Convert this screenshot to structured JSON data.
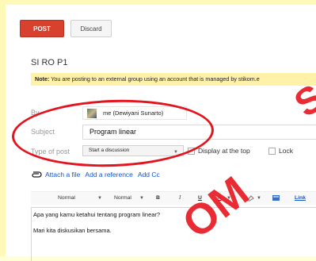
{
  "toolbar_top": {
    "post_label": "POST",
    "discard_label": "Discard"
  },
  "group_title": "SI RO P1",
  "note": {
    "prefix": "Note:",
    "text": " You are posting to an external group using an account that is managed by stikom.e"
  },
  "form": {
    "by_label": "By",
    "by_value": "me (Dewiyani Sunarto)",
    "subject_label": "Subject",
    "subject_value": "Program linear",
    "type_label": "Type of post",
    "type_value": "Start a discussion",
    "display_top_label": "Display at the top",
    "lock_label": "Lock"
  },
  "links": {
    "attach": "Attach a file",
    "reference": "Add a reference",
    "cc": "Add Cc"
  },
  "editor_toolbar": {
    "font_style": "Normal",
    "font_size": "Normal",
    "bold": "B",
    "italic": "I",
    "underline": "U",
    "text_color": "A",
    "link": "Link"
  },
  "editor": {
    "line1": "Apa yang kamu ketahui tentang program linear?",
    "line2": "Mari kita diskusikan bersama."
  },
  "watermark": {
    "top_right": "S",
    "middle": "OM"
  },
  "colors": {
    "post_button": "#d9412f",
    "annotation_ellipse": "#e4141e",
    "link": "#1155cc"
  }
}
